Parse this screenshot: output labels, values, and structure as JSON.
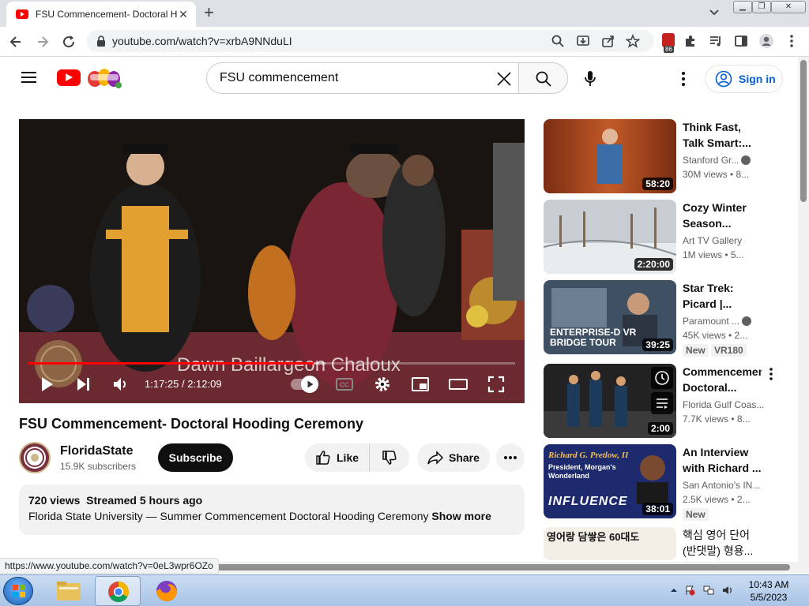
{
  "browser": {
    "tab_title": "FSU Commencement- Doctoral Hooding Ceremony - YouTube",
    "url": "youtube.com/watch?v=xrbA9NNduLI",
    "extension_badge": "86",
    "status_url": "https://www.youtube.com/watch?v=0eL3wpr6OZo"
  },
  "masthead": {
    "search_value": "FSU commencement",
    "signin_label": "Sign in"
  },
  "player": {
    "overlay_name": "Dawn Baillargeon Chaloux",
    "time_current": "1:17:25",
    "time_total": "2:12:09",
    "time_display": "1:17:25 / 2:12:09",
    "progress_fraction": 0.586,
    "buffered_fraction": 0.61
  },
  "video": {
    "title": "FSU Commencement- Doctoral Hooding Ceremony",
    "channel": "FloridaState",
    "subscribers": "15.9K subscribers",
    "subscribe_label": "Subscribe",
    "like_label": "Like",
    "share_label": "Share",
    "views": "720 views",
    "streamed": "Streamed 5 hours ago",
    "description": "Florida State University — Summer Commencement Doctoral Hooding Ceremony",
    "show_more": "Show more"
  },
  "recommendations": [
    {
      "title": "Think Fast, Talk Smart:...",
      "channel": "Stanford Gr...",
      "meta": "30M views • 8...",
      "duration": "58:20",
      "verified": true
    },
    {
      "title": "Cozy Winter Season...",
      "channel": "Art TV Gallery",
      "meta": "1M views • 5...",
      "duration": "2:20:00",
      "verified": false
    },
    {
      "title": "Star Trek: Picard |...",
      "channel": "Paramount ...",
      "meta": "45K views • 2...",
      "duration": "39:25",
      "verified": true,
      "badges": [
        "New",
        "VR180"
      ],
      "thumb_text": "ENTERPRISE-D VR BRIDGE TOUR"
    },
    {
      "title": "Commencement Doctoral...",
      "channel": "Florida Gulf Coas...",
      "meta": "7.7K views • 8...",
      "duration": "2:00",
      "verified": false
    },
    {
      "title": "An Interview with Richard ...",
      "channel": "San Antonio's IN...",
      "meta": "2.5K views • 2...",
      "duration": "38:01",
      "verified": false,
      "badges": [
        "New"
      ],
      "thumb_text_1": "Richard G. Pretlow, II",
      "thumb_text_2": "President, Morgan's Wonderland",
      "thumb_text_3": "INFLUENCE"
    },
    {
      "title": "핵심 영어 단어 (반댓말) 형용...",
      "channel": "",
      "meta": "",
      "duration": "",
      "verified": false,
      "thumb_text": "영어랑 담쌓은 60대도"
    }
  ],
  "taskbar": {
    "time": "10:43 AM",
    "date": "5/5/2023"
  },
  "colors": {
    "youtube_red": "#ff0000",
    "link_blue": "#065fd4",
    "fsu_garnet": "#782f40",
    "fsu_gold": "#ceb888"
  }
}
